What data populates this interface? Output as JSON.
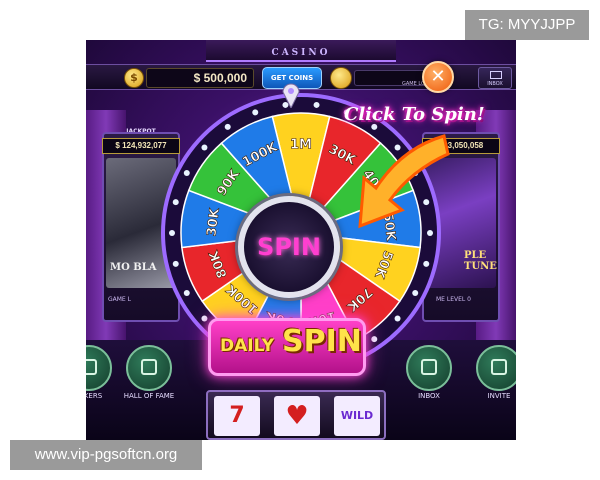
{
  "casino": {
    "title": "CASINO",
    "balance": "$ 500,000",
    "get_coins_label": "GET COINS",
    "game_lobby_label": "GAME LOBBY",
    "close_symbol": "✕",
    "inbox_label": "INBOX"
  },
  "jackpot": {
    "title": "JACKPOT",
    "left_value": "$ 124,932,077",
    "right_value": "303,050,058"
  },
  "slots": {
    "left_name": "MO BLA",
    "right_name": "PLE TUNE",
    "left_level": "GAME L",
    "right_level": "ME LEVEL 0"
  },
  "wheel": {
    "segments": [
      "1M",
      "30K",
      "40K",
      "250K",
      "50K",
      "70K",
      "10K",
      "70K",
      "100K",
      "80K",
      "30K",
      "90K",
      "100K"
    ],
    "colors": [
      "#ffd21f",
      "#e8262b",
      "#35c23a",
      "#1f7be8",
      "#ffd21f",
      "#e8262b",
      "#ff3fc8",
      "#1f7be8",
      "#ffd21f",
      "#e8262b",
      "#1f7be8",
      "#35c23a",
      "#1f7be8"
    ],
    "spin_label": "SPIN"
  },
  "promo": {
    "click_to_spin": "Click To Spin!",
    "daily": "DAILY",
    "spin": "SPIN"
  },
  "bottom_nav": {
    "items": [
      "KERS",
      "HALL OF FAME",
      "INBOX",
      "INVITE"
    ]
  },
  "reels": [
    "7",
    "♥",
    "WILD"
  ],
  "watermarks": {
    "tg": "TG: MYYJJPP",
    "site": "www.vip-pgsoftcn.org"
  }
}
